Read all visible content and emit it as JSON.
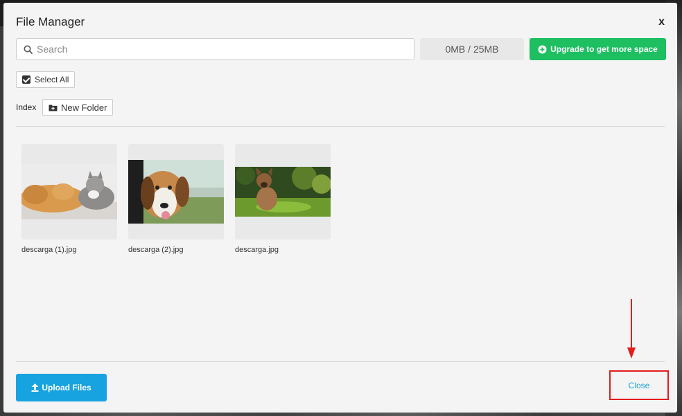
{
  "modal": {
    "title": "File Manager",
    "close_glyph": "x"
  },
  "search": {
    "placeholder": "Search",
    "value": ""
  },
  "storage": {
    "quota_text": "0MB / 25MB"
  },
  "upgrade": {
    "label": "Upgrade to get more space",
    "icon": "plus-circle-icon",
    "color": "#1dbf60"
  },
  "toolbar": {
    "select_all_label": "Select All",
    "select_all_checked": true,
    "breadcrumb_label": "Index",
    "new_folder_label": "New Folder",
    "new_folder_icon": "folder-plus-icon"
  },
  "files": [
    {
      "name": "descarga (1).jpg",
      "image": "golden-retriever-and-gray-cat-lying-together"
    },
    {
      "name": "descarga (2).jpg",
      "image": "beagle-looking-out-of-car-window"
    },
    {
      "name": "descarga.jpg",
      "image": "french-bulldog-sitting-on-grass"
    }
  ],
  "footer": {
    "upload_label": "Upload Files",
    "upload_icon": "upload-icon",
    "upload_color": "#17a3e0",
    "close_label": "Close",
    "close_highlight_color": "#e61b1b"
  }
}
